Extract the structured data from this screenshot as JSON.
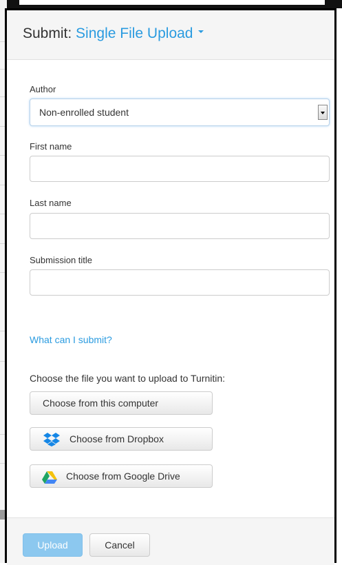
{
  "header": {
    "title_prefix": "Submit:",
    "title_mode": "Single File Upload"
  },
  "form": {
    "author": {
      "label": "Author",
      "selected": "Non-enrolled student"
    },
    "first_name": {
      "label": "First name",
      "value": ""
    },
    "last_name": {
      "label": "Last name",
      "value": ""
    },
    "submission_title": {
      "label": "Submission title",
      "value": ""
    }
  },
  "help_link": "What can I submit?",
  "upload": {
    "prompt": "Choose the file you want to upload to Turnitin:",
    "computer_label": "Choose from this computer",
    "dropbox_label": "Choose from Dropbox",
    "gdrive_label": "Choose from Google Drive"
  },
  "footer": {
    "upload_label": "Upload",
    "cancel_label": "Cancel"
  },
  "colors": {
    "accent": "#2a9be0",
    "upload_disabled": "#8cc8ef"
  }
}
